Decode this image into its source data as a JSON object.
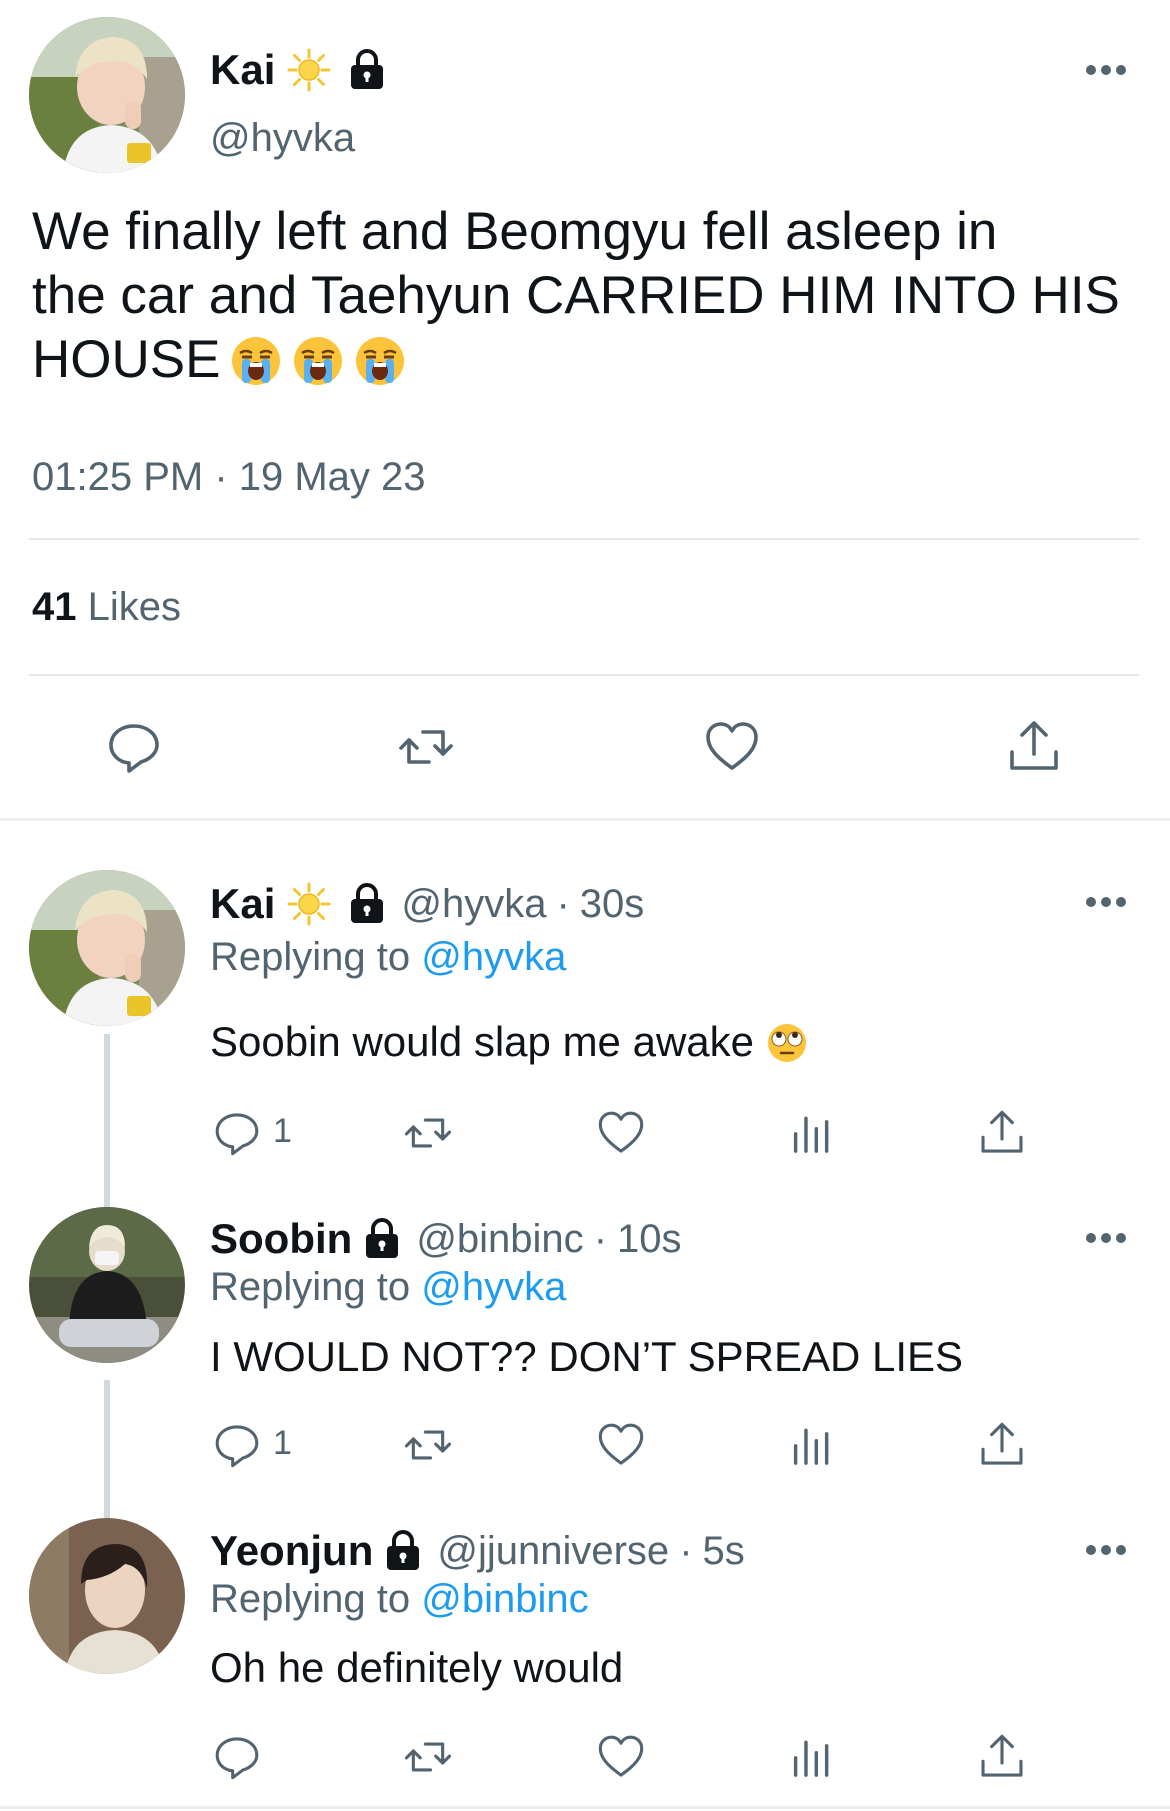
{
  "main_tweet": {
    "display_name": "Kai",
    "handle": "@hyvka",
    "text_line1": "We finally left and Beomgyu fell asleep in",
    "text_line2": "the car and Taehyun CARRIED HIM INTO HIS",
    "text_line3": "HOUSE",
    "emoji": "loudly-crying-face",
    "timestamp": "01:25 PM · 19 May 23",
    "likes_count": "41",
    "likes_label": "Likes"
  },
  "replies": [
    {
      "display_name": "Kai",
      "handle": "@hyvka",
      "dot": "·",
      "time": "30s",
      "replying_label": "Replying to",
      "replying_to": "@hyvka",
      "text": "Soobin would slap me awake",
      "emoji": "face-with-rolling-eyes",
      "reply_count": "1"
    },
    {
      "display_name": "Soobin",
      "handle": "@binbinc",
      "dot": "·",
      "time": "10s",
      "replying_label": "Replying to",
      "replying_to": "@hyvka",
      "text": "I WOULD NOT?? DON’T SPREAD LIES",
      "reply_count": "1"
    },
    {
      "display_name": "Yeonjun",
      "handle": "@jjunniverse",
      "dot": "·",
      "time": "5s",
      "replying_label": "Replying to",
      "replying_to": "@binbinc",
      "text": "Oh he definitely would",
      "reply_count": ""
    }
  ],
  "icons": {
    "verified_like": "sun-icon",
    "protected": "lock-icon",
    "more": "more-icon",
    "reply": "reply-icon",
    "retweet": "retweet-icon",
    "like": "heart-icon",
    "views": "views-icon",
    "share": "share-icon"
  },
  "colors": {
    "text_primary": "#0f1419",
    "text_secondary": "#536471",
    "mention": "#1d9bf0",
    "divider": "#e6e9eb"
  }
}
